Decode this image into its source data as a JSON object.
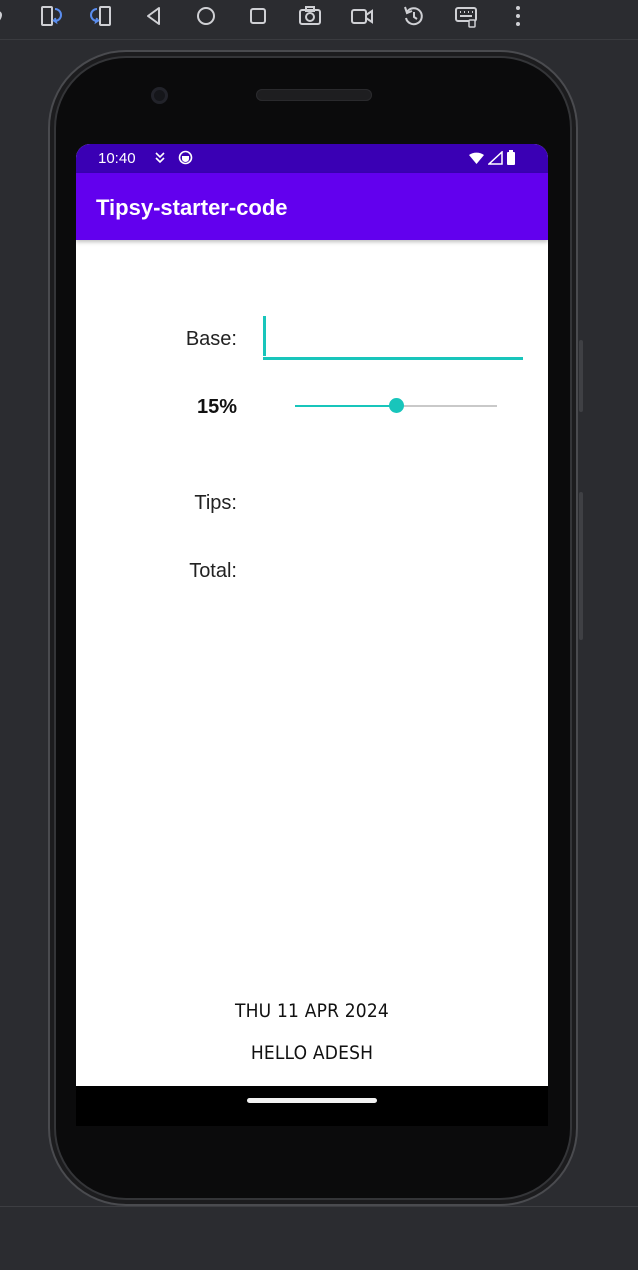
{
  "toolbar": {
    "items": [
      {
        "name": "rotate-left-icon"
      },
      {
        "name": "rotate-right-icon"
      },
      {
        "name": "back-icon"
      },
      {
        "name": "home-icon"
      },
      {
        "name": "overview-icon"
      },
      {
        "name": "screenshot-icon"
      },
      {
        "name": "screen-record-icon"
      },
      {
        "name": "snapshot-restore-icon"
      },
      {
        "name": "keyboard-icon"
      },
      {
        "name": "more-options-icon"
      }
    ]
  },
  "status_bar": {
    "time": "10:40",
    "background": "#3a00b4"
  },
  "app_bar": {
    "title": "Tipsy-starter-code",
    "background": "#6200ee"
  },
  "form": {
    "base_label": "Base:",
    "base_value": "",
    "percent_label": "15%",
    "slider_fraction": 0.5,
    "tips_label": "Tips:",
    "total_label": "Total:",
    "accent": "#18c5bb"
  },
  "footer": {
    "date": "THU 11 APR 2024",
    "greeting": "HELLO ADESH"
  }
}
